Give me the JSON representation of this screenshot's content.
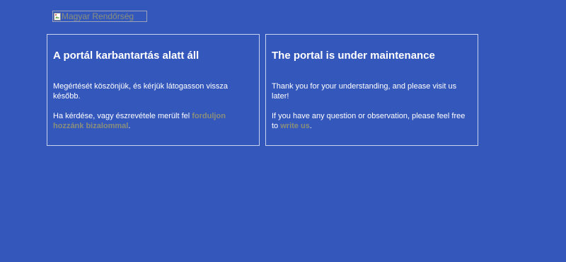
{
  "logo": {
    "alt_text": "Magyar Rendőrség",
    "icon": "broken-image-icon"
  },
  "hungarian": {
    "title": "A portál karbantartás alatt áll",
    "message": "Megértését köszönjük, és kérjük látogasson vissza később.",
    "contact_prefix": "Ha kérdése, vagy észrevétele merült fel ",
    "contact_link": "forduljon hozzánk bizalommal",
    "contact_suffix": "."
  },
  "english": {
    "title": "The portal is under maintenance",
    "message": "Thank you for your understanding, and please visit us later!",
    "contact_prefix": "If you have any question or observation, please feel free to ",
    "contact_link": "write us",
    "contact_suffix": "."
  },
  "colors": {
    "background": "#3457bc",
    "text": "#ffffff",
    "link": "#8a8f7a",
    "panel_border": "#c9d3ee"
  }
}
